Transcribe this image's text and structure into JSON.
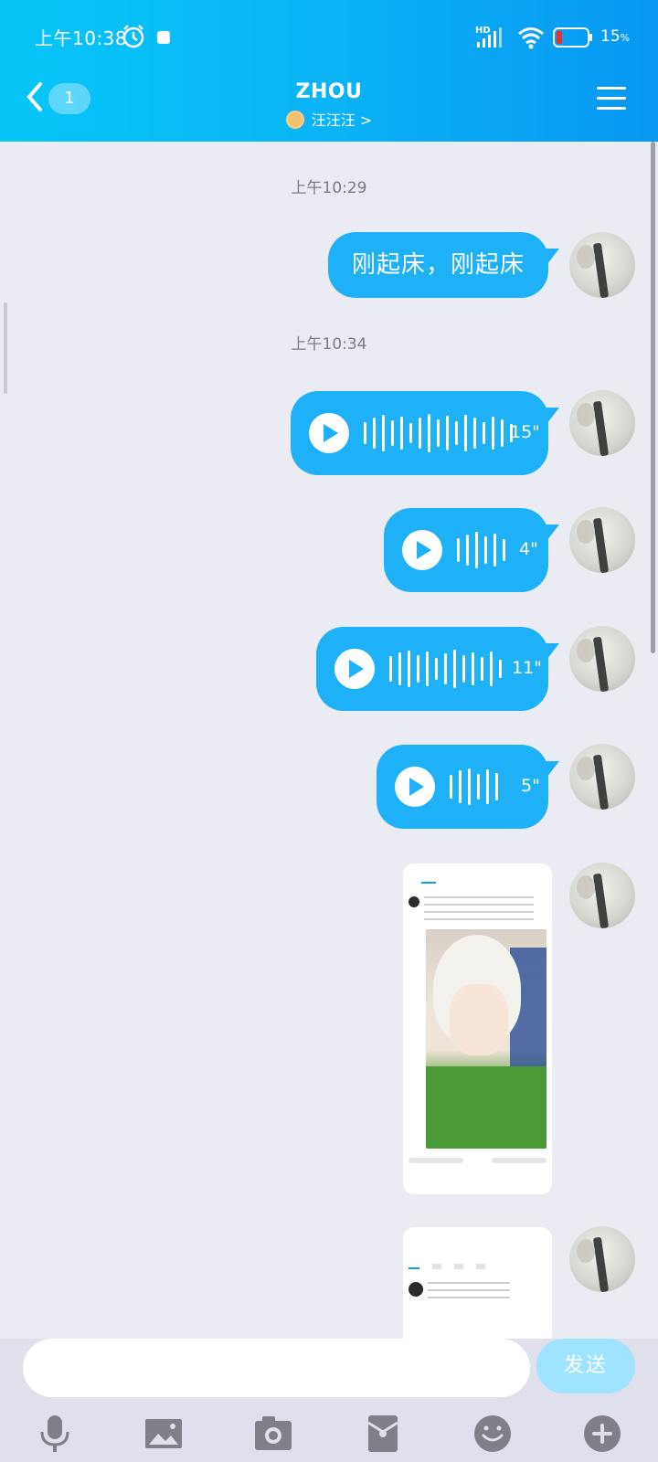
{
  "status_bar": {
    "time": "上午10:38",
    "battery": "15",
    "battery_unit": "%"
  },
  "header": {
    "unread_count": "1",
    "title": "ZHOU",
    "subtitle": "汪汪汪 >"
  },
  "messages": {
    "timestamp_1": "上午10:29",
    "text_1": "刚起床，刚起床",
    "timestamp_2": "上午10:34",
    "voice_1_duration": "15\"",
    "voice_2_duration": "4\"",
    "voice_3_duration": "11\"",
    "voice_4_duration": "5\""
  },
  "input": {
    "placeholder": "",
    "send_label": "发送"
  },
  "colors": {
    "header_start": "#07c6f7",
    "header_end": "#0897f2",
    "bubble": "#1eb1f8",
    "background": "#ebebf3"
  },
  "toolbar_icons": [
    "microphone-icon",
    "image-icon",
    "camera-icon",
    "red-packet-icon",
    "emoji-icon",
    "plus-icon"
  ]
}
